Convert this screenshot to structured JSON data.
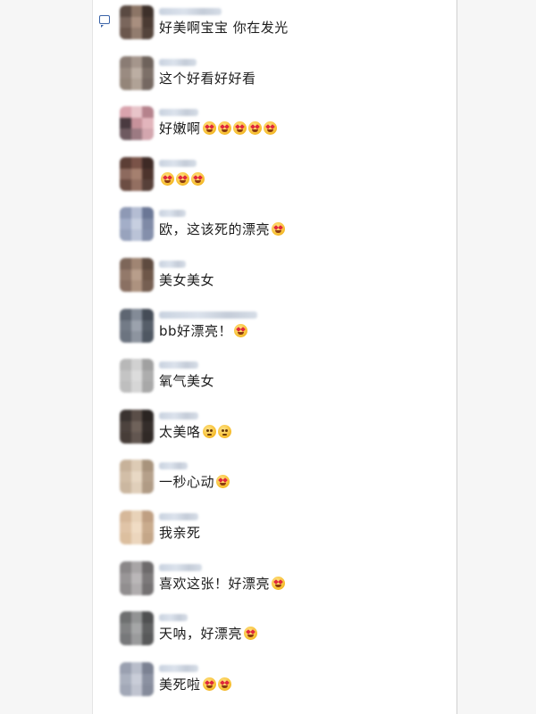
{
  "comments": [
    {
      "text": "好美啊宝宝 你在发光",
      "emojis": [],
      "avatar_colors": [
        "#5a4a42",
        "#8c7566",
        "#3d302a",
        "#7a665c",
        "#a88f7f",
        "#4b3b33",
        "#6b574d",
        "#927c6e",
        "#54443b"
      ]
    },
    {
      "text": "这个好看好好看",
      "emojis": [],
      "avatar_colors": [
        "#8a7c74",
        "#a5968c",
        "#6e625b",
        "#9a8b81",
        "#bcae a3",
        "#7d7068",
        "#948579",
        "#b0a296",
        "#756861"
      ]
    },
    {
      "text": "好嫩啊",
      "emojis": [
        "heart-eyes",
        "heart-eyes",
        "heart-eyes",
        "heart-eyes",
        "heart-eyes"
      ],
      "avatar_colors": [
        "#d9a3ad",
        "#e8c4c9",
        "#b5828c",
        "#4a3a40",
        "#c7929b",
        "#e2b5bc",
        "#6e5a60",
        "#9c7a82",
        "#d3a6ae"
      ]
    },
    {
      "text": "",
      "emojis": [
        "heart-eyes",
        "heart-eyes",
        "heart-eyes"
      ],
      "avatar_colors": [
        "#5c3e36",
        "#7a5348",
        "#3e2a25",
        "#8d6a5e",
        "#a5806f",
        "#4d342d",
        "#6c4d43",
        "#936f61",
        "#574039"
      ]
    },
    {
      "text": "欧，这该死的漂亮",
      "emojis": [
        "heart-eyes"
      ],
      "avatar_colors": [
        "#8e99b5",
        "#b4bdd3",
        "#6b7796",
        "#a3aec8",
        "#c7cfe0",
        "#7f8aa6",
        "#98a3bd",
        "#bac3d7",
        "#848fab"
      ]
    },
    {
      "text": "美女美女",
      "emojis": [],
      "avatar_colors": [
        "#7d6659",
        "#a08573",
        "#5e4a3f",
        "#93796a",
        "#b89e8b",
        "#6e5749",
        "#8a7062",
        "#ad927f",
        "#765f52"
      ]
    },
    {
      "text": "bb好漂亮！",
      "emojis": [
        "heart-eyes"
      ],
      "avatar_colors": [
        "#5e6672",
        "#838b97",
        "#454c57",
        "#737b87",
        "#9ba2ad",
        "#565e69",
        "#6c7480",
        "#8d949f",
        "#4f5762"
      ]
    },
    {
      "text": "氧气美女",
      "emojis": [],
      "avatar_colors": [
        "#b8b8b8",
        "#d1d1d1",
        "#a0a0a0",
        "#c4c4c4",
        "#dcdcdc",
        "#adadad",
        "#bebebe",
        "#d6d6d6",
        "#a8a8a8"
      ]
    },
    {
      "text": "太美咯",
      "emojis": [
        "shy",
        "shy"
      ],
      "avatar_colors": [
        "#3a3330",
        "#5a4e48",
        "#2a2422",
        "#4d433e",
        "#6f625a",
        "#342d2a",
        "#473d38",
        "#625650",
        "#302926"
      ]
    },
    {
      "text": "一秒心动",
      "emojis": [
        "heart-eyes"
      ],
      "avatar_colors": [
        "#c7b29a",
        "#ddcbb5",
        "#a8937c",
        "#d2bea7",
        "#e8d8c4",
        "#b5a08a",
        "#cbb7a0",
        "#e0cfba",
        "#b09b85"
      ]
    },
    {
      "text": "我亲死",
      "emojis": [],
      "avatar_colors": [
        "#d6b89a",
        "#e8d2b8",
        "#bf9f82",
        "#e0c4a7",
        "#f0dcc4",
        "#c9ab8d",
        "#dcbf9f",
        "#ecd6bd",
        "#c4a688"
      ]
    },
    {
      "text": "喜欢这张！好漂亮",
      "emojis": [
        "heart-eyes"
      ],
      "avatar_colors": [
        "#8a8788",
        "#a8a5a6",
        "#6d6a6b",
        "#999697",
        "#bab7b8",
        "#7c797a",
        "#918e8f",
        "#b0adae",
        "#747172"
      ]
    },
    {
      "text": "天呐，好漂亮",
      "emojis": [
        "heart-eyes"
      ],
      "avatar_colors": [
        "#6e6f70",
        "#929394",
        "#4f5051",
        "#818283",
        "#a5a6a7",
        "#5f6061",
        "#77787a",
        "#9a9b9c",
        "#58595a"
      ]
    },
    {
      "text": "美死啦",
      "emojis": [
        "heart-eyes",
        "heart-eyes"
      ],
      "avatar_colors": [
        "#9aa0b0",
        "#b8bdca",
        "#7b8192",
        "#abb1bf",
        "#c9cdd8",
        "#8b91a1",
        "#a2a8b7",
        "#c0c4d0",
        "#858b9b"
      ]
    }
  ],
  "name_widths": [
    70,
    42,
    44,
    42,
    30,
    30,
    110,
    44,
    44,
    32,
    44,
    48,
    32,
    44
  ]
}
